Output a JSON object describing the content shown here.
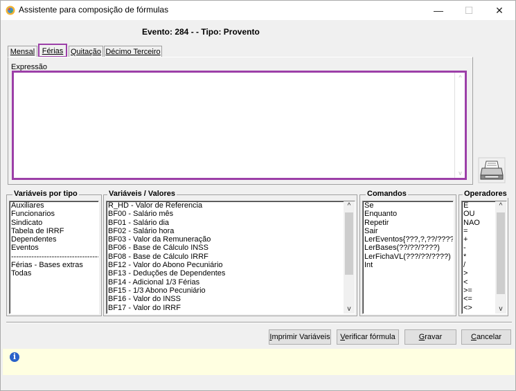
{
  "window": {
    "title": "Assistente para composição de fórmulas",
    "controls": {
      "minimize": "—",
      "maximize": "☐",
      "close": "✕"
    }
  },
  "header": {
    "text": "Evento: 284 -  - Tipo: Provento"
  },
  "tabs": [
    {
      "label": "Mensal",
      "selected": false
    },
    {
      "label": "Férias",
      "selected": true
    },
    {
      "label": "Quitação",
      "selected": false
    },
    {
      "label": "Décimo Terceiro",
      "selected": false
    }
  ],
  "expression": {
    "label": "Expressão",
    "value": ""
  },
  "print_icon": "printer-icon",
  "variaveis_tipo": {
    "title": "Variáveis por tipo",
    "items": [
      "Auxiliares",
      "Funcionarios",
      "Sindicato",
      "Tabela de IRRF",
      "Dependentes",
      "Eventos",
      "------------------------------------",
      "Férias - Bases extras",
      "Todas"
    ]
  },
  "variaveis_valores": {
    "title": "Variáveis / Valores",
    "items": [
      "R_HD - Valor de Referencia",
      "BF00 - Salário mês",
      "BF01 - Salário dia",
      "BF02 - Salário hora",
      "BF03 - Valor da Remuneração",
      "BF06 - Base de Cálculo INSS",
      "BF08 - Base de Cálculo IRRF",
      "BF12 - Valor do Abono Pecuniário",
      "BF13 - Deduções de Dependentes",
      "BF14 - Adicional 1/3 Férias",
      "BF15 - 1/3 Abono Pecuniário",
      "BF16 - Valor do INSS",
      "BF17 - Valor do IRRF"
    ]
  },
  "comandos": {
    "title": "Comandos",
    "items": [
      "Se",
      "Enquanto",
      "Repetir",
      "Sair",
      "LerEventos{???,?,??/????}",
      "LerBases(??/??/????)",
      "LerFichaVL(???/??/????)",
      "Int"
    ]
  },
  "operadores": {
    "title": "Operadores",
    "items": [
      "E",
      "OU",
      "NAO",
      "=",
      "+",
      "-",
      "*",
      "/",
      ">",
      "<",
      ">=",
      "<=",
      "<>"
    ]
  },
  "scroll": {
    "up": "^",
    "down": "v"
  },
  "buttons": {
    "imprimir": {
      "pre": "",
      "key": "I",
      "post": "mprimir Variáveis"
    },
    "verificar": {
      "pre": "",
      "key": "V",
      "post": "erificar fórmula"
    },
    "gravar": {
      "pre": "",
      "key": "G",
      "post": "ravar"
    },
    "cancelar": {
      "pre": "",
      "key": "C",
      "post": "ancelar"
    }
  },
  "info": {
    "icon": "info-icon",
    "glyph": "i",
    "message": ""
  }
}
